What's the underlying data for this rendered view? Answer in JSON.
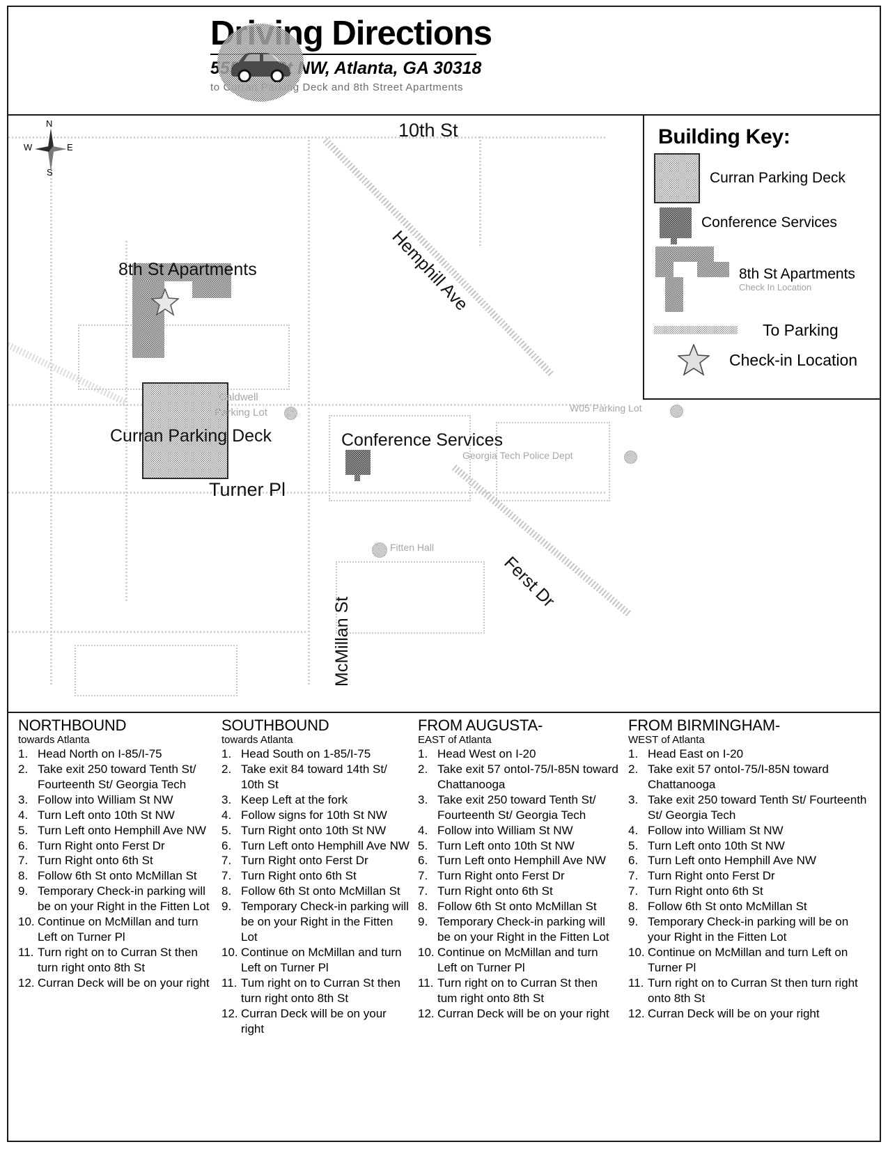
{
  "header": {
    "title": "Driving Directions",
    "address": "555 8th St NW, Atlanta, GA 30318",
    "subtitle": "to Curran Parking Deck and 8th Street Apartments",
    "icon": "car-icon"
  },
  "map": {
    "compass": {
      "north": "N",
      "south": "S",
      "east": "E",
      "west": "W"
    },
    "labels": {
      "tenth_st": "10th St",
      "hemphill_ave": "Hemphill Ave",
      "ferst_dr": "Ferst Dr",
      "mcmillan_st": "McMillan St",
      "turner_pl": "Turner Pl",
      "eighth_st_apartments": "8th St Apartments",
      "curran_parking_deck": "Curran Parking Deck",
      "conference_services": "Conference Services",
      "caldwell_parking_lot_line1": "Caldwell",
      "caldwell_parking_lot_line2": "Parking Lot",
      "w05_parking_lot": "W05 Parking Lot",
      "georgia_tech_police_dept": "Georgia Tech Police Dept",
      "fitten_hall": "Fitten Hall"
    }
  },
  "building_key": {
    "title": "Building Key:",
    "items": [
      {
        "label": "Curran Parking Deck",
        "sub": "",
        "swatch": "curran-deck-swatch"
      },
      {
        "label": "Conference Services",
        "sub": "",
        "swatch": "conference-services-swatch"
      },
      {
        "label": "8th St Apartments",
        "sub": "Check In Location",
        "swatch": "apartments-swatch"
      },
      {
        "label": "To Parking",
        "sub": "",
        "swatch": "to-parking-swatch"
      },
      {
        "label": "Check-in Location",
        "sub": "",
        "swatch": "check-in-star-swatch"
      }
    ]
  },
  "directions": [
    {
      "heading": "NORTHBOUND",
      "subheading": "towards Atlanta",
      "steps": [
        {
          "n": "1.",
          "t": "Head North on I-85/I-75"
        },
        {
          "n": "2.",
          "t": "Take exit 250 toward Tenth St/ Fourteenth St/ Georgia Tech"
        },
        {
          "n": "3.",
          "t": "Follow into William St NW"
        },
        {
          "n": "4.",
          "t": "Turn Left onto 10th St NW"
        },
        {
          "n": "5.",
          "t": "Turn Left onto Hemphill Ave NW"
        },
        {
          "n": "6.",
          "t": "Turn Right onto Ferst Dr"
        },
        {
          "n": "7.",
          "t": "Turn Right onto 6th St"
        },
        {
          "n": "8.",
          "t": "Follow 6th St onto McMillan St"
        },
        {
          "n": "9.",
          "t": "Temporary Check-in parking will be on your Right in the Fitten Lot"
        },
        {
          "n": "10.",
          "t": "Continue on McMillan and turn Left on Turner Pl"
        },
        {
          "n": "11.",
          "t": "Turn right on to Curran St then turn right onto 8th St"
        },
        {
          "n": "12.",
          "t": "Curran Deck will be on your right"
        }
      ]
    },
    {
      "heading": "SOUTHBOUND",
      "subheading": "towards Atlanta",
      "steps": [
        {
          "n": "1.",
          "t": "Head South on 1-85/I-75"
        },
        {
          "n": "2.",
          "t": "Take exit 84 toward 14th St/ 10th St"
        },
        {
          "n": "3.",
          "t": "Keep Left at the fork"
        },
        {
          "n": "4.",
          "t": "Follow signs for 10th St NW"
        },
        {
          "n": "5.",
          "t": "Turn Right onto 10th St NW"
        },
        {
          "n": "6.",
          "t": "Turn Left onto Hemphill Ave NW"
        },
        {
          "n": "7.",
          "t": "Turn Right onto Ferst Dr"
        },
        {
          "n": "7.",
          "t": "Turn Right onto 6th St"
        },
        {
          "n": "8.",
          "t": "Follow 6th St onto McMillan St"
        },
        {
          "n": "9.",
          "t": "Temporary Check-in parking will be on your Right in the Fitten Lot"
        },
        {
          "n": "10.",
          "t": "Continue on McMillan and turn Left on Turner Pl"
        },
        {
          "n": "11.",
          "t": "Tum right on to Curran St then turn right onto 8th St"
        },
        {
          "n": "12.",
          "t": "Curran Deck will be on your right"
        }
      ]
    },
    {
      "heading": "FROM AUGUSTA-",
      "subheading": "EAST of Atlanta",
      "steps": [
        {
          "n": "1.",
          "t": "Head West on I-20"
        },
        {
          "n": "2.",
          "t": "Take exit 57 ontoI-75/I-85N toward Chattanooga"
        },
        {
          "n": "3.",
          "t": "Take exit 250 toward Tenth St/ Fourteenth St/ Georgia Tech"
        },
        {
          "n": "4.",
          "t": "Follow into William St NW"
        },
        {
          "n": "5.",
          "t": "Turn Left onto 10th St NW"
        },
        {
          "n": "6.",
          "t": "Turn Left onto Hemphill Ave NW"
        },
        {
          "n": "7.",
          "t": "Turn Right onto Ferst Dr"
        },
        {
          "n": "7.",
          "t": "Turn Right onto 6th St"
        },
        {
          "n": "8.",
          "t": "Follow 6th St onto McMillan St"
        },
        {
          "n": "9.",
          "t": "Temporary Check-in parking will be on your Right in the Fitten Lot"
        },
        {
          "n": "10.",
          "t": "Continue on McMillan and turn Left on Turner Pl"
        },
        {
          "n": "11.",
          "t": "Turn right on to Curran St then tum right onto 8th St"
        },
        {
          "n": "12.",
          "t": "Curran Deck will be on your right"
        }
      ]
    },
    {
      "heading": "FROM BIRMINGHAM-",
      "subheading": "WEST of Atlanta",
      "steps": [
        {
          "n": "1.",
          "t": "Head East on I-20"
        },
        {
          "n": "2.",
          "t": "Take exit 57 ontoI-75/I-85N toward Chattanooga"
        },
        {
          "n": "3.",
          "t": "Take exit 250 toward Tenth St/ Fourteenth St/ Georgia Tech"
        },
        {
          "n": "4.",
          "t": "Follow into William St NW"
        },
        {
          "n": "5.",
          "t": "Turn Left onto 10th St NW"
        },
        {
          "n": "6.",
          "t": "Turn Left onto Hemphill Ave NW"
        },
        {
          "n": "7.",
          "t": "Turn Right onto Ferst Dr"
        },
        {
          "n": "7.",
          "t": "Turn Right onto 6th St"
        },
        {
          "n": "8.",
          "t": "Follow 6th St onto McMillan St"
        },
        {
          "n": "9.",
          "t": "Temporary Check-in parking will be on your Right in the Fitten Lot"
        },
        {
          "n": "10.",
          "t": "Continue on McMillan and turn Left on Turner Pl"
        },
        {
          "n": "11.",
          "t": "Turn right on to Curran St then turn right onto 8th St"
        },
        {
          "n": "12.",
          "t": "Curran Deck will be on your right"
        }
      ]
    }
  ]
}
